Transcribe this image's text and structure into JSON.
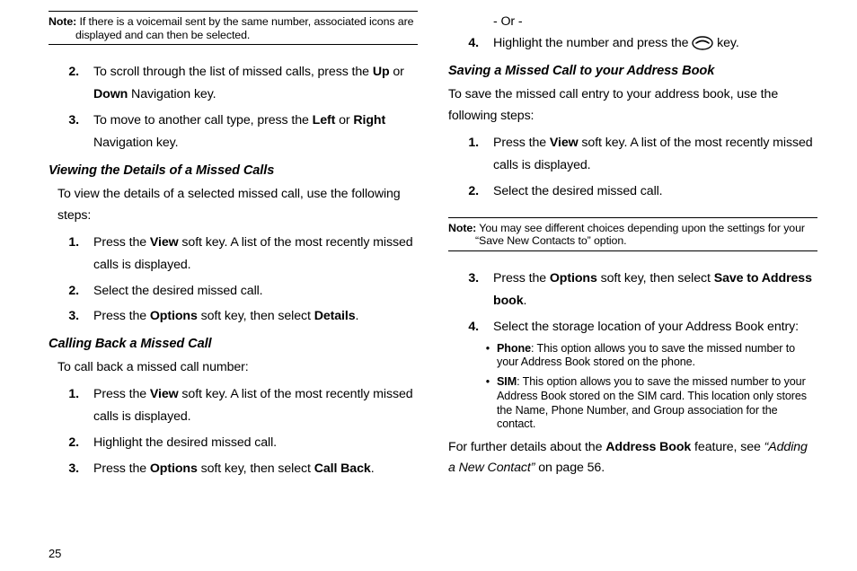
{
  "page_number": "25",
  "col1": {
    "note1": {
      "label": "Note:",
      "line1": "If there is a voicemail sent by the same number, associated icons are",
      "line2": "displayed and can then be selected."
    },
    "steps_top": {
      "n2": "2.",
      "t2a": "To scroll through the list of missed calls, press the ",
      "t2b": "Up",
      "t2c": " or ",
      "t2d": "Down",
      "t2e": " Navigation key.",
      "n3": "3.",
      "t3a": "To move to another call type, press the ",
      "t3b": "Left",
      "t3c": " or ",
      "t3d": "Right",
      "t3e": " Navigation key."
    },
    "head_view": "Viewing the Details of a Missed Calls",
    "intro_view": "To view the details of a selected missed call, use the following steps:",
    "steps_view": {
      "n1": "1.",
      "t1a": "Press the ",
      "t1b": "View",
      "t1c": " soft key. A list of the most recently missed calls is displayed.",
      "n2": "2.",
      "t2": "Select the desired missed call.",
      "n3": "3.",
      "t3a": "Press the ",
      "t3b": "Options",
      "t3c": " soft key, then select ",
      "t3d": "Details",
      "t3e": "."
    },
    "head_callback": "Calling Back a Missed Call",
    "intro_callback": "To call back a missed call number:",
    "steps_callback": {
      "n1": "1.",
      "t1a": "Press the ",
      "t1b": "View",
      "t1c": " soft key. A list of the most recently missed calls is displayed.",
      "n2": "2.",
      "t2": "Highlight the desired missed call.",
      "n3": "3.",
      "t3a": "Press the ",
      "t3b": "Options",
      "t3c": " soft key, then select ",
      "t3d": "Call Back",
      "t3e": "."
    }
  },
  "col2": {
    "or": " - Or -",
    "step4": {
      "n": "4.",
      "a": "Highlight the number and press the ",
      "b": " key."
    },
    "head_save": "Saving a Missed Call to your Address Book",
    "intro_save": "To save the missed call entry to your address book, use the following steps:",
    "steps_save1": {
      "n1": "1.",
      "t1a": "Press the ",
      "t1b": "View",
      "t1c": " soft key. A list of the most recently missed calls is displayed.",
      "n2": "2.",
      "t2": "Select the desired missed call."
    },
    "note2": {
      "label": "Note:",
      "line1": "You may see different choices depending upon the settings for your",
      "line2": "“Save New Contacts to” option."
    },
    "steps_save2": {
      "n3": "3.",
      "t3a": "Press the ",
      "t3b": "Options",
      "t3c": " soft key, then select ",
      "t3d": "Save to Address book",
      "t3e": ".",
      "n4": "4.",
      "t4": "Select the storage location of your Address Book entry:"
    },
    "bullets": {
      "phone_b": "Phone",
      "phone_t": ": This option allows you to save the missed number to your Address Book stored on the phone.",
      "sim_b": "SIM",
      "sim_t": ": This option allows you to save the missed number to your Address Book stored on the SIM card. This location only stores the Name, Phone Number, and Group association for the contact."
    },
    "closing_a": "For further details about the ",
    "closing_b": "Address Book",
    "closing_c": " feature, see ",
    "closing_d": "“Adding a New Contact”",
    "closing_e": " on page 56."
  }
}
